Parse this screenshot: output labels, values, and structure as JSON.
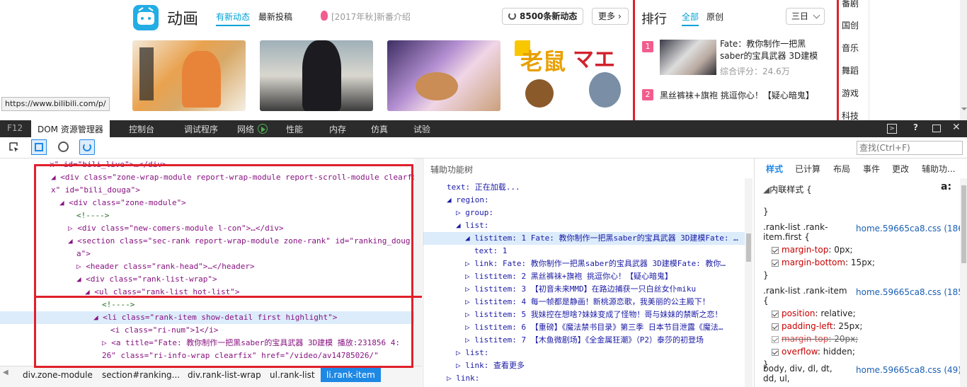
{
  "site": {
    "section_title": "动画",
    "tabs": [
      "有新动态",
      "最新投稿"
    ],
    "promo": "[2017年秋]新番介绍",
    "new_dynamics_btn": "8500条新动态",
    "more_btn": "更多",
    "url_tooltip": "https://www.bilibili.com/p/"
  },
  "ranking": {
    "title": "排行",
    "tabs": [
      "全部",
      "原创"
    ],
    "period": "三日",
    "items": [
      {
        "num": "1",
        "title": "Fate：教你制作一把黑saber的宝具武器 3D建模",
        "score": "综合评分：24.6万"
      },
      {
        "num": "2",
        "title": "黑丝裤袜+旗袍 挑逗你心！【疑心暗鬼】"
      }
    ]
  },
  "side_categories": [
    "番剧",
    "国创",
    "音乐",
    "舞蹈",
    "游戏",
    "科技"
  ],
  "devtools": {
    "tabs": [
      "F12",
      "DOM 资源管理器",
      "控制台",
      "调试程序",
      "网络",
      "性能",
      "内存",
      "仿真",
      "试验"
    ],
    "search_placeholder": "查找(Ctrl+F)",
    "dom_lines": [
      {
        "indent": 0,
        "text": "x\" id=\"bili_live\">…</div>"
      },
      {
        "indent": 1,
        "text": "◢ <div class=\"zone-wrap-module report-wrap-module report-scroll-module clearfi"
      },
      {
        "indent": 1,
        "text": "x\" id=\"bili_douga\">"
      },
      {
        "indent": 2,
        "text": "◢ <div class=\"zone-module\">"
      },
      {
        "indent": 4,
        "text": "<!---->"
      },
      {
        "indent": 3,
        "text": "▷ <div class=\"new-comers-module l-con\">…</div>"
      },
      {
        "indent": 3,
        "text": "◢ <section class=\"sec-rank report-wrap-module zone-rank\" id=\"ranking_doug"
      },
      {
        "indent": 4,
        "text": "a\">"
      },
      {
        "indent": 4,
        "text": "▷ <header class=\"rank-head\">…</header>"
      },
      {
        "indent": 4,
        "text": "◢ <div class=\"rank-list-wrap\">"
      },
      {
        "indent": 5,
        "text": "◢ <ul class=\"rank-list hot-list\">"
      },
      {
        "indent": 7,
        "text": "<!---->"
      },
      {
        "indent": 6,
        "text": "◢ <li class=\"rank-item show-detail first highlight\">"
      },
      {
        "indent": 8,
        "text": "<i class=\"ri-num\">1</i>"
      },
      {
        "indent": 7,
        "text": "▷ <a title=\"Fate: 教你制作一把黑saber的宝具武器 3D建模 播放:231856 4:"
      },
      {
        "indent": 7,
        "text": "26\" class=\"ri-info-wrap clearfix\" href=\"/video/av14785026/\""
      }
    ],
    "accessibility_title": "辅助功能树",
    "acc_lines": [
      {
        "indent": 1,
        "text": "text: 正在加载..."
      },
      {
        "indent": 1,
        "text": "◢ region:"
      },
      {
        "indent": 2,
        "text": "▷ group:"
      },
      {
        "indent": 2,
        "text": "◢ list:"
      },
      {
        "indent": 3,
        "text": "◢ listitem: 1 Fate: 教你制作一把黑saber的宝具武器 3D建模Fate: …"
      },
      {
        "indent": 4,
        "text": "text: 1"
      },
      {
        "indent": 3,
        "text": "▷ link: Fate: 教你制作一把黑saber的宝具武器 3D建模Fate: 教你…"
      },
      {
        "indent": 3,
        "text": "▷ listitem: 2 黑丝裤袜+旗袍 挑逗你心！【疑心暗鬼】"
      },
      {
        "indent": 3,
        "text": "▷ listitem: 3 【初音未来MMD】在路边捕获一只白丝女仆miku"
      },
      {
        "indent": 3,
        "text": "▷ listitem: 4 每一帧都是静画！新桃源恋歌，我美丽的公主殿下！"
      },
      {
        "indent": 3,
        "text": "▷ listitem: 5 我妹控在想啥?妹妹变成了怪物！哥与妹妹的禁断之恋！"
      },
      {
        "indent": 3,
        "text": "▷ listitem: 6 【重磅】《魔法禁书目录》第三季 日本节目泄露《魔法…"
      },
      {
        "indent": 3,
        "text": "▷ listitem: 7 【木鱼微剧场】《全金属狂潮》（P2）泰莎的初登场"
      },
      {
        "indent": 2,
        "text": "▷ list:"
      },
      {
        "indent": 2,
        "text": "▷ link: 查看更多"
      },
      {
        "indent": 1,
        "text": "▷ link:"
      }
    ],
    "style_tabs": [
      "样式",
      "已计算",
      "布局",
      "事件",
      "更改",
      "辅助功..."
    ],
    "inline_style": "内联样式  {",
    "rules": [
      {
        "selector": ".rank-list .rank-item.first  {",
        "source": "home.59665ca8.css (1860)",
        "props": [
          [
            "margin-top",
            "0px;",
            false
          ],
          [
            "margin-bottom",
            "15px;",
            false
          ]
        ]
      },
      {
        "selector": ".rank-list .rank-item  {",
        "source": "home.59665ca8.css (1854)",
        "props": [
          [
            "position",
            "relative;",
            false
          ],
          [
            "padding-left",
            "25px;",
            false
          ],
          [
            "margin-top",
            "20px;",
            true
          ],
          [
            "overflow",
            "hidden;",
            false
          ]
        ]
      },
      {
        "selector": "body, div, dl, dt, dd, ul,",
        "source": "home.59665ca8.css (49)",
        "props": []
      }
    ],
    "breadcrumbs": [
      "div.zone-module",
      "section#ranking...",
      "div.rank-list-wrap",
      "ul.rank-list",
      "li.rank-item"
    ]
  }
}
